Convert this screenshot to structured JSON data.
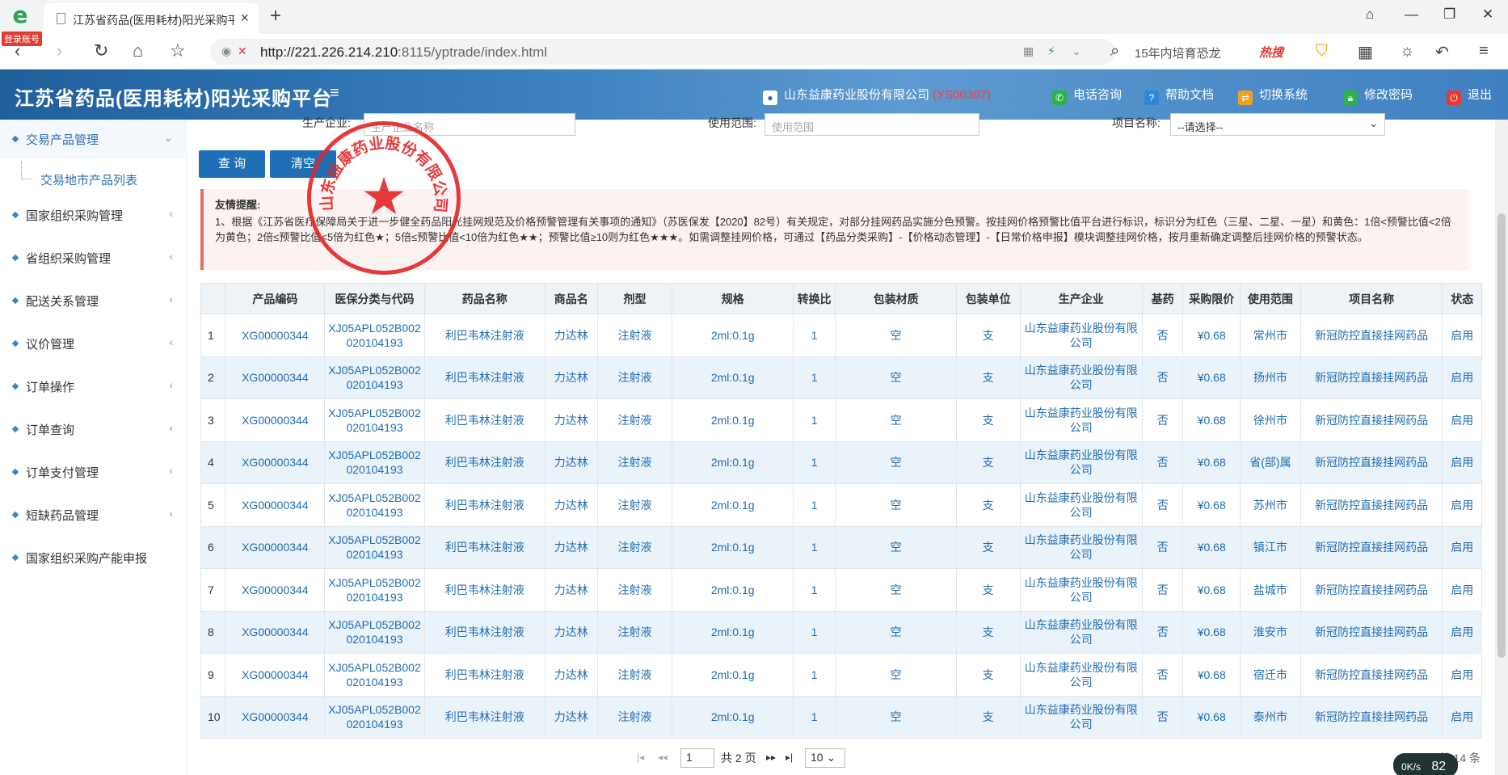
{
  "browser": {
    "login_badge": "登录账号",
    "tab_title": "江苏省药品(医用耗材)阳光采购平",
    "url_host": "http://221.226.214.210",
    "url_rest": ":8115/yptrade/index.html",
    "search_text": "15年内培育恐龙",
    "search_hot": "热搜"
  },
  "header": {
    "title": "江苏省药品(医用耗材)阳光采购平台",
    "company": "山东益康药业股份有限公司",
    "company_code": "(YS00307)",
    "phone": "电话咨询",
    "help": "帮助文档",
    "switch": "切换系统",
    "password": "修改密码",
    "logout": "退出"
  },
  "sidebar": {
    "items": [
      {
        "label": "交易产品管理",
        "chev": "⌄"
      },
      {
        "label": "交易地市产品列表"
      },
      {
        "label": "国家组织采购管理",
        "chev": "‹"
      },
      {
        "label": "省组织采购管理",
        "chev": "‹"
      },
      {
        "label": "配送关系管理",
        "chev": "‹"
      },
      {
        "label": "议价管理",
        "chev": "‹"
      },
      {
        "label": "订单操作",
        "chev": "‹"
      },
      {
        "label": "订单查询",
        "chev": "‹"
      },
      {
        "label": "订单支付管理",
        "chev": "‹"
      },
      {
        "label": "短缺药品管理",
        "chev": "‹"
      },
      {
        "label": "国家组织采购产能申报"
      }
    ]
  },
  "filters": {
    "manufacturer_label": "生产企业:",
    "manufacturer_placeholder": "生产企业名称",
    "scope_label": "使用范围:",
    "scope_placeholder": "使用范围",
    "project_label": "项目名称:",
    "project_value": "--请选择--"
  },
  "buttons": {
    "query": "查 询",
    "clear": "清空"
  },
  "stamp": {
    "text": "山东益康药业股份有限公司"
  },
  "notice": {
    "title": "友情提醒:",
    "body": "1、根据《江苏省医疗保障局关于进一步健全药品阳光挂网规范及价格预警管理有关事项的通知》（苏医保发【2020】82号）有关规定，对部分挂网药品实施分色预警。按挂网价格预警比值平台进行标识，标识分为红色（三星、二星、一星）和黄色：1倍<预警比值<2倍为黄色；2倍≤预警比值<5倍为红色★；5倍≤预警比值<10倍为红色★★；预警比值≥10则为红色★★★。如需调整挂网价格，可通过【药品分类采购】-【价格动态管理】-【日常价格申报】模块调整挂网价格，按月重新确定调整后挂网价格的预警状态。"
  },
  "table": {
    "columns": [
      "",
      "产品编码",
      "医保分类与代码",
      "药品名称",
      "商品名",
      "剂型",
      "规格",
      "转换比",
      "包装材质",
      "包装单位",
      "生产企业",
      "基药",
      "采购限价",
      "使用范围",
      "项目名称",
      "状态"
    ],
    "rows": [
      [
        "1",
        "XG00000344",
        "XJ05APL052B002020104193",
        "利巴韦林注射液",
        "力达林",
        "注射液",
        "2ml:0.1g",
        "1",
        "空",
        "支",
        "山东益康药业股份有限公司",
        "否",
        "¥0.68",
        "常州市",
        "新冠防控直接挂网药品",
        "启用"
      ],
      [
        "2",
        "XG00000344",
        "XJ05APL052B002020104193",
        "利巴韦林注射液",
        "力达林",
        "注射液",
        "2ml:0.1g",
        "1",
        "空",
        "支",
        "山东益康药业股份有限公司",
        "否",
        "¥0.68",
        "扬州市",
        "新冠防控直接挂网药品",
        "启用"
      ],
      [
        "3",
        "XG00000344",
        "XJ05APL052B002020104193",
        "利巴韦林注射液",
        "力达林",
        "注射液",
        "2ml:0.1g",
        "1",
        "空",
        "支",
        "山东益康药业股份有限公司",
        "否",
        "¥0.68",
        "徐州市",
        "新冠防控直接挂网药品",
        "启用"
      ],
      [
        "4",
        "XG00000344",
        "XJ05APL052B002020104193",
        "利巴韦林注射液",
        "力达林",
        "注射液",
        "2ml:0.1g",
        "1",
        "空",
        "支",
        "山东益康药业股份有限公司",
        "否",
        "¥0.68",
        "省(部)属",
        "新冠防控直接挂网药品",
        "启用"
      ],
      [
        "5",
        "XG00000344",
        "XJ05APL052B002020104193",
        "利巴韦林注射液",
        "力达林",
        "注射液",
        "2ml:0.1g",
        "1",
        "空",
        "支",
        "山东益康药业股份有限公司",
        "否",
        "¥0.68",
        "苏州市",
        "新冠防控直接挂网药品",
        "启用"
      ],
      [
        "6",
        "XG00000344",
        "XJ05APL052B002020104193",
        "利巴韦林注射液",
        "力达林",
        "注射液",
        "2ml:0.1g",
        "1",
        "空",
        "支",
        "山东益康药业股份有限公司",
        "否",
        "¥0.68",
        "镇江市",
        "新冠防控直接挂网药品",
        "启用"
      ],
      [
        "7",
        "XG00000344",
        "XJ05APL052B002020104193",
        "利巴韦林注射液",
        "力达林",
        "注射液",
        "2ml:0.1g",
        "1",
        "空",
        "支",
        "山东益康药业股份有限公司",
        "否",
        "¥0.68",
        "盐城市",
        "新冠防控直接挂网药品",
        "启用"
      ],
      [
        "8",
        "XG00000344",
        "XJ05APL052B002020104193",
        "利巴韦林注射液",
        "力达林",
        "注射液",
        "2ml:0.1g",
        "1",
        "空",
        "支",
        "山东益康药业股份有限公司",
        "否",
        "¥0.68",
        "淮安市",
        "新冠防控直接挂网药品",
        "启用"
      ],
      [
        "9",
        "XG00000344",
        "XJ05APL052B002020104193",
        "利巴韦林注射液",
        "力达林",
        "注射液",
        "2ml:0.1g",
        "1",
        "空",
        "支",
        "山东益康药业股份有限公司",
        "否",
        "¥0.68",
        "宿迁市",
        "新冠防控直接挂网药品",
        "启用"
      ],
      [
        "10",
        "XG00000344",
        "XJ05APL052B002020104193",
        "利巴韦林注射液",
        "力达林",
        "注射液",
        "2ml:0.1g",
        "1",
        "空",
        "支",
        "山东益康药业股份有限公司",
        "否",
        "¥0.68",
        "泰州市",
        "新冠防控直接挂网药品",
        "启用"
      ]
    ]
  },
  "pager": {
    "page": "1",
    "total_pages": "共 2 页",
    "page_size": "10",
    "summary": "1 - 10，共 14 条"
  },
  "status": {
    "speed": "0K/s",
    "gauge": "82"
  }
}
